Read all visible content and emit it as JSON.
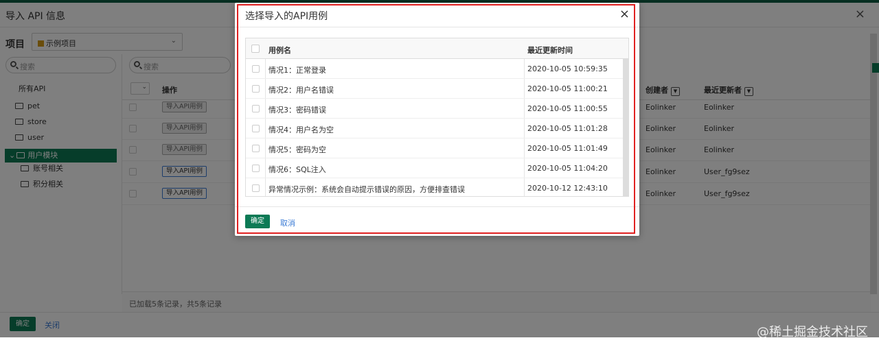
{
  "window": {
    "title": "导入 API 信息",
    "close_icon": "×"
  },
  "project": {
    "label": "项目",
    "selected": "示例项目"
  },
  "left_search": {
    "placeholder": "搜索"
  },
  "mid_search": {
    "placeholder": "搜索"
  },
  "tree": {
    "all": "所有API",
    "items": [
      "pet",
      "store",
      "user"
    ],
    "active": "用户模块",
    "children": [
      "账号相关",
      "积分相关"
    ]
  },
  "table": {
    "col_op": "操作",
    "col_creator": "创建者",
    "col_updater": "最近更新者",
    "rows": [
      {
        "btn": "导入API用例",
        "creator": "Eolinker",
        "updater": "Eolinker"
      },
      {
        "btn": "导入API用例",
        "creator": "Eolinker",
        "updater": "Eolinker"
      },
      {
        "btn": "导入API用例",
        "creator": "Eolinker",
        "updater": "Eolinker"
      },
      {
        "btn": "导入API用例",
        "creator": "Eolinker",
        "updater": "User_fg9sez"
      },
      {
        "btn": "导入API用例",
        "creator": "Eolinker",
        "updater": "User_fg9sez"
      }
    ],
    "footer": "已加载5条记录，共5条记录"
  },
  "bottom": {
    "ok": "确定",
    "close": "关闭"
  },
  "watermark": "@稀土掘金技术社区",
  "dialog": {
    "title": "选择导入的API用例",
    "close_icon": "×",
    "col_name": "用例名",
    "col_time": "最近更新时间",
    "rows": [
      {
        "name": "情况1：正常登录",
        "time": "2020-10-05 10:59:35"
      },
      {
        "name": "情况2：用户名错误",
        "time": "2020-10-05 11:00:21"
      },
      {
        "name": "情况3：密码错误",
        "time": "2020-10-05 11:00:55"
      },
      {
        "name": "情况4：用户名为空",
        "time": "2020-10-05 11:01:28"
      },
      {
        "name": "情况5：密码为空",
        "time": "2020-10-05 11:01:49"
      },
      {
        "name": "情况6：SQL注入",
        "time": "2020-10-05 11:04:20"
      },
      {
        "name": "异常情况示例：系统会自动提示错误的原因，方便排查错误",
        "time": "2020-10-12 12:43:10"
      }
    ],
    "ok": "确定",
    "cancel": "取消"
  },
  "colors": {
    "primary": "#0c7a55",
    "link": "#3a7bd5",
    "highlight_frame": "#e02020"
  }
}
